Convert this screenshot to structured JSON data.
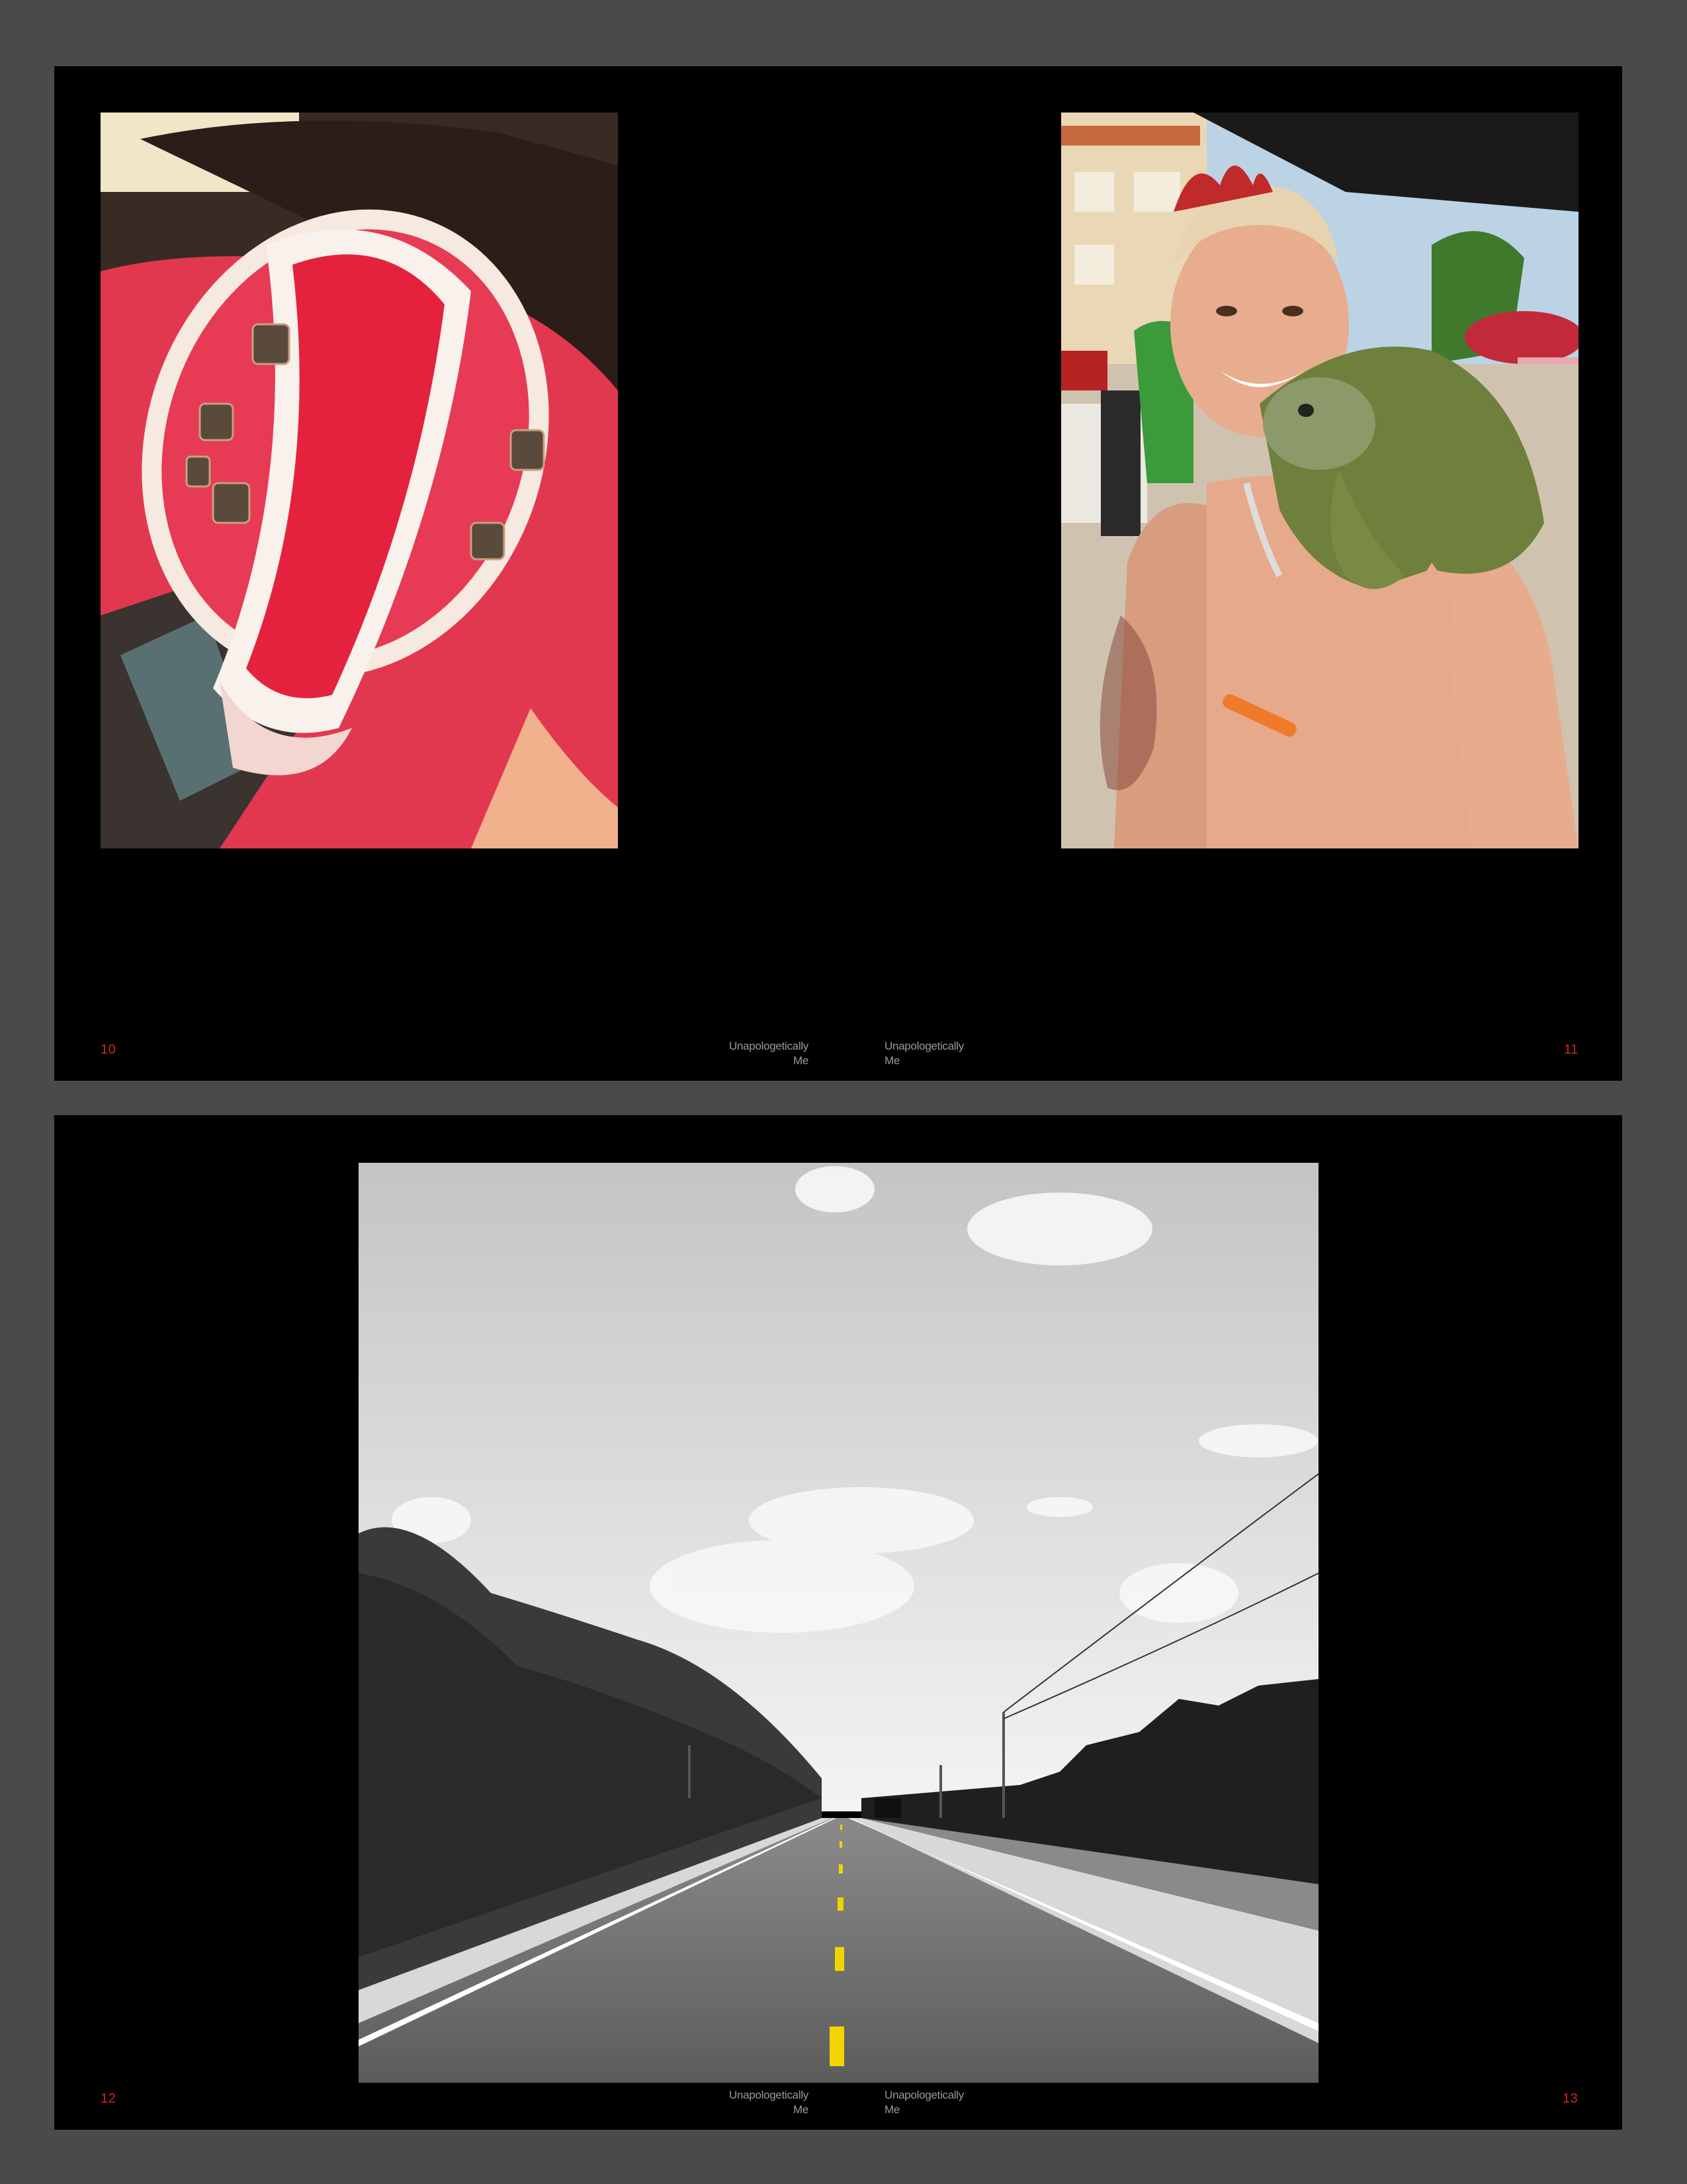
{
  "spreads": [
    {
      "left_page": {
        "number": "10",
        "running_title_line1": "Unapologetically",
        "running_title_line2": "Me"
      },
      "right_page": {
        "number": "11",
        "running_title_line1": "Unapologetically",
        "running_title_line2": "Me"
      }
    },
    {
      "left_page": {
        "number": "12",
        "running_title_line1": "Unapologetically",
        "running_title_line2": "Me"
      },
      "right_page": {
        "number": "13",
        "running_title_line1": "Unapologetically",
        "running_title_line2": "Me"
      }
    }
  ],
  "colors": {
    "background": "#4a4a4a",
    "page": "#000000",
    "folio": "#d1261c",
    "running_title": "#9a9a9a",
    "road_line": "#f2d400"
  }
}
